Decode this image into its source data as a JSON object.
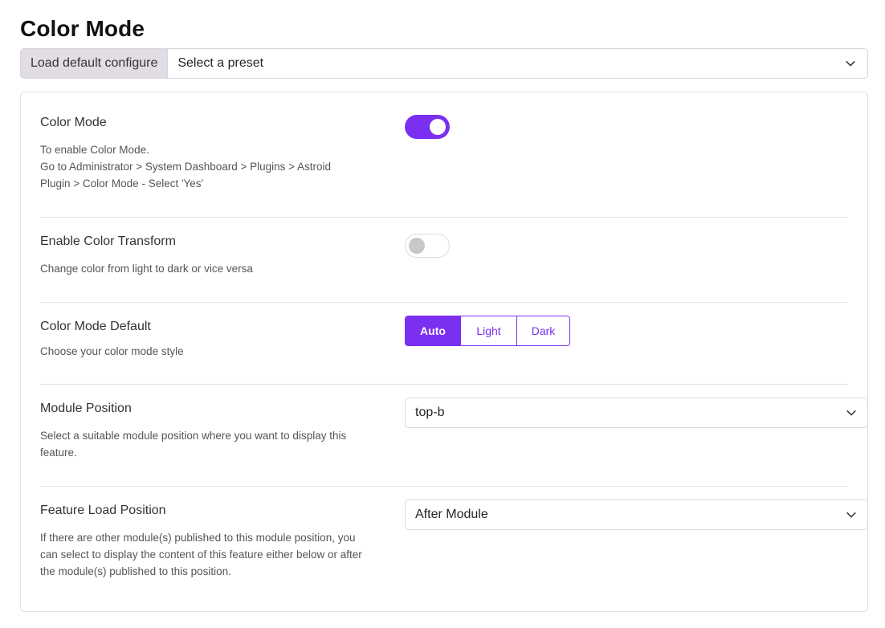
{
  "page": {
    "title": "Color Mode"
  },
  "preset": {
    "label": "Load default configure",
    "placeholder": "Select a preset"
  },
  "settings": {
    "color_mode": {
      "label": "Color Mode",
      "desc_line1": "To enable Color Mode.",
      "desc_line2": "Go to Administrator > System Dashboard > Plugins > Astroid Plugin > Color Mode - Select 'Yes'",
      "enabled": true
    },
    "color_transform": {
      "label": "Enable Color Transform",
      "desc": "Change color from light to dark or vice versa",
      "enabled": false
    },
    "color_mode_default": {
      "label": "Color Mode Default",
      "desc": "Choose your color mode style",
      "options": [
        "Auto",
        "Light",
        "Dark"
      ],
      "selected": "Auto"
    },
    "module_position": {
      "label": "Module Position",
      "desc": "Select a suitable module position where you want to display this feature.",
      "value": "top-b"
    },
    "feature_load_position": {
      "label": "Feature Load Position",
      "desc": "If there are other module(s) published to this module position, you can select to display the content of this feature either below or after the module(s) published to this position.",
      "value": "After Module"
    }
  },
  "colors": {
    "accent": "#7b2ff0",
    "toggle_off_knob": "#c8c8c8",
    "preset_label_bg": "#e2dde5"
  },
  "icons": {
    "dropdown": "chevron-down-icon"
  }
}
